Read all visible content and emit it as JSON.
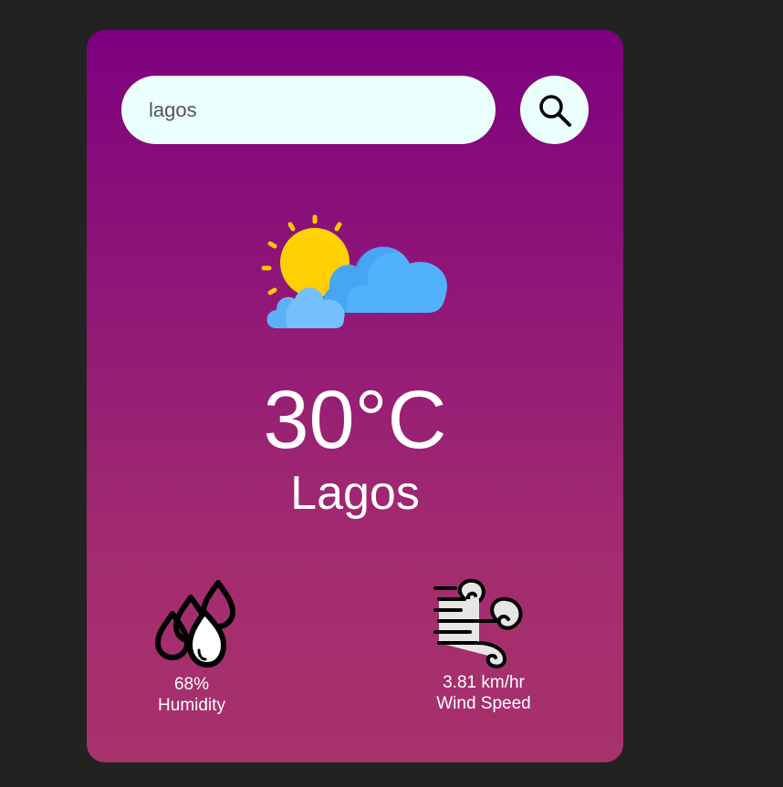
{
  "search": {
    "value": "lagos",
    "icon": "search-icon"
  },
  "weather": {
    "icon": "partly-cloudy-icon",
    "temperature": "30°C",
    "city": "Lagos"
  },
  "humidity": {
    "icon": "humidity-drops-icon",
    "value": "68%",
    "label": "Humidity"
  },
  "wind": {
    "icon": "wind-icon",
    "value": "3.81 km/hr",
    "label": "Wind Speed"
  },
  "colors": {
    "page_background": "#222222",
    "card_gradient_top": "#7d017f",
    "card_gradient_bottom": "#a8326b",
    "input_background": "#ebfffc",
    "sun": "#ffd400",
    "cloud": "#5ab4fa"
  }
}
